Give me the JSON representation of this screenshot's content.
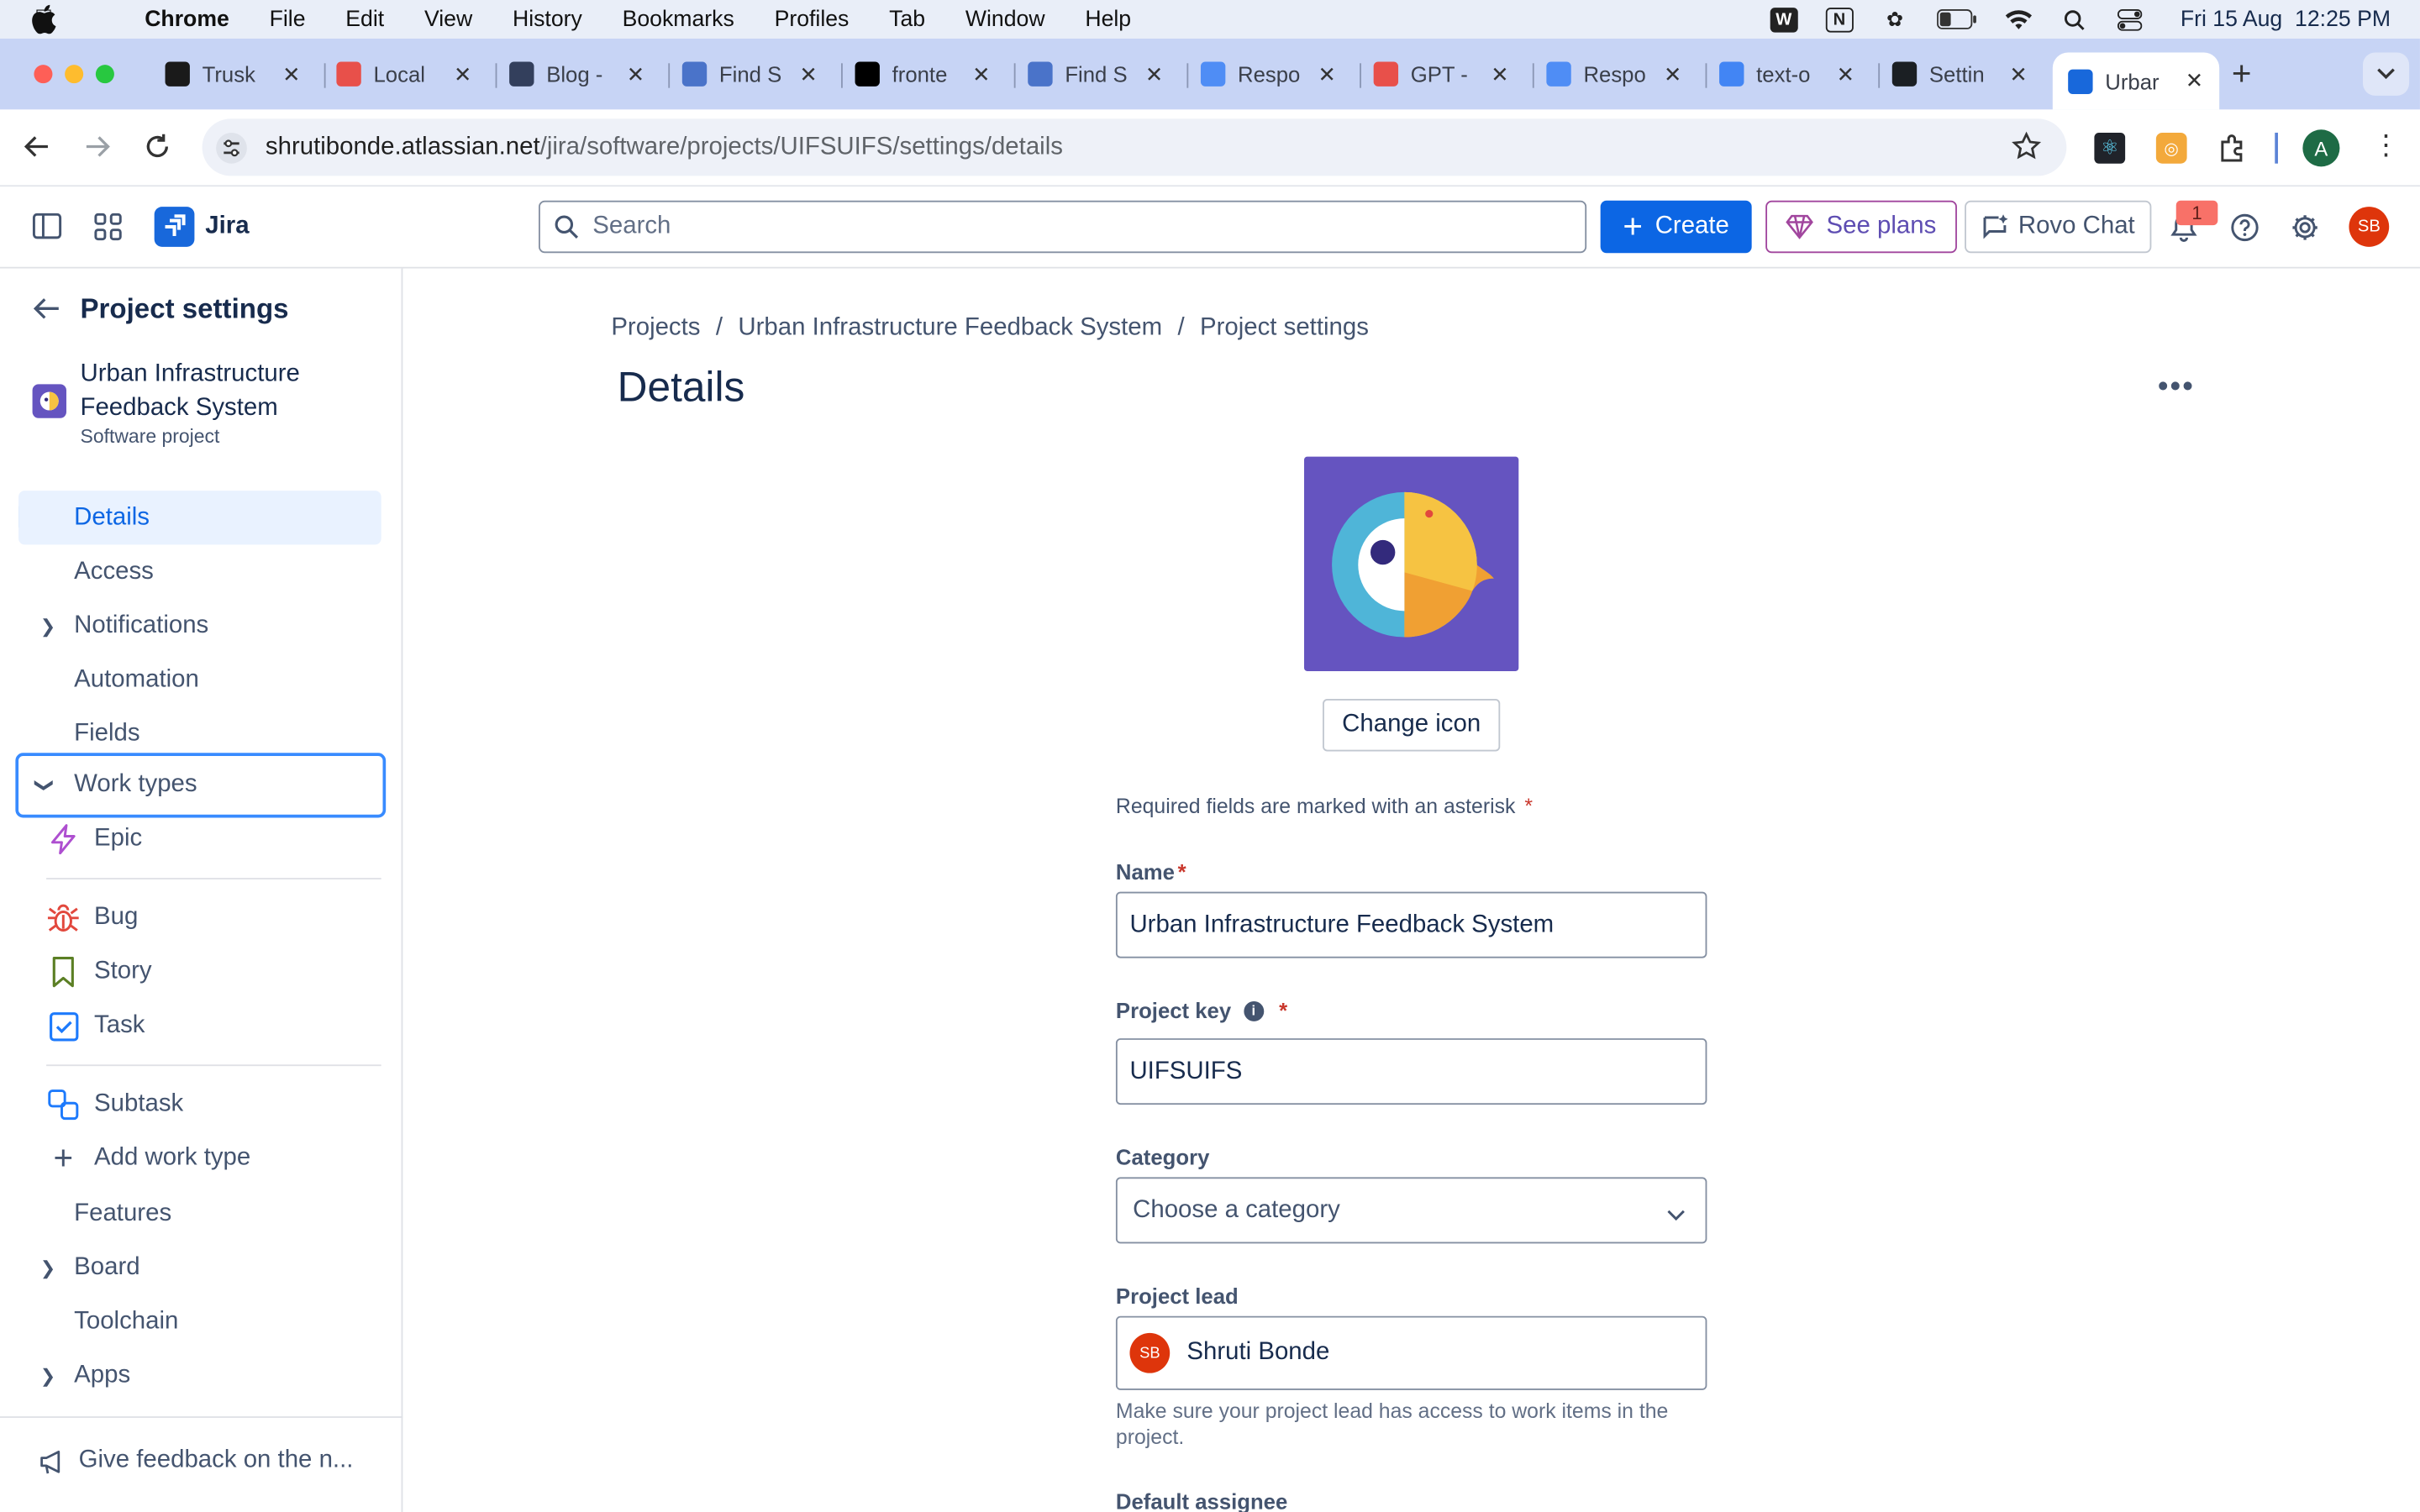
{
  "menubar": {
    "app": "Chrome",
    "items": [
      "File",
      "Edit",
      "View",
      "History",
      "Bookmarks",
      "Profiles",
      "Tab",
      "Window",
      "Help"
    ],
    "clock": "Fri 15 Aug  12:25 PM"
  },
  "tabs": [
    {
      "title": "Trusk",
      "fav_color": "#1a1a1a"
    },
    {
      "title": "Local",
      "fav_color": "#e8504a"
    },
    {
      "title": "Blog -",
      "fav_color": "#333f5c"
    },
    {
      "title": "Find S",
      "fav_color": "#4a73c9"
    },
    {
      "title": "fronte",
      "fav_color": "#000000"
    },
    {
      "title": "Find S",
      "fav_color": "#4a73c9"
    },
    {
      "title": "Respo",
      "fav_color": "#4f8df5"
    },
    {
      "title": "GPT -",
      "fav_color": "#e8504a"
    },
    {
      "title": "Respo",
      "fav_color": "#4f8df5"
    },
    {
      "title": "text-o",
      "fav_color": "#4285f4"
    },
    {
      "title": "Settin",
      "fav_color": "#1b1f23"
    },
    {
      "title": "Urbar",
      "fav_color": "#1868db"
    }
  ],
  "address": {
    "host": "shrutibonde.atlassian.net",
    "path": "/jira/software/projects/UIFSUIFS/settings/details"
  },
  "profile_initial": "A",
  "jira": {
    "product": "Jira",
    "search_placeholder": "Search",
    "create": "Create",
    "see_plans": "See plans",
    "rovo_chat": "Rovo Chat",
    "notif_count": "1",
    "avatar": "SB"
  },
  "sidebar": {
    "back_title": "Project settings",
    "project_name_line1": "Urban Infrastructure",
    "project_name_line2": "Feedback System",
    "project_type": "Software project",
    "items": {
      "details": "Details",
      "access": "Access",
      "notifications": "Notifications",
      "automation": "Automation",
      "fields": "Fields",
      "work_types": "Work types",
      "features": "Features",
      "board": "Board",
      "toolchain": "Toolchain",
      "apps": "Apps"
    },
    "work_types": {
      "epic": "Epic",
      "bug": "Bug",
      "story": "Story",
      "task": "Task",
      "subtask": "Subtask",
      "add": "Add work type"
    },
    "feedback": "Give feedback on the n..."
  },
  "main": {
    "breadcrumb": [
      "Projects",
      "Urban Infrastructure Feedback System",
      "Project settings"
    ],
    "title": "Details",
    "change_icon": "Change icon",
    "required_note": "Required fields are marked with an asterisk",
    "name_label": "Name",
    "name_value": "Urban Infrastructure Feedback System",
    "key_label": "Project key",
    "key_value": "UIFSUIFS",
    "category_label": "Category",
    "category_placeholder": "Choose a category",
    "lead_label": "Project lead",
    "lead_avatar": "SB",
    "lead_name": "Shruti Bonde",
    "lead_help_1": "Make sure your project lead has access to work items in the",
    "lead_help_2": "project.",
    "default_assignee_label": "Default assignee"
  },
  "colors": {
    "brand": "#0c66e4",
    "icon_bg": "#6554c0",
    "avatar": "#de350b"
  }
}
